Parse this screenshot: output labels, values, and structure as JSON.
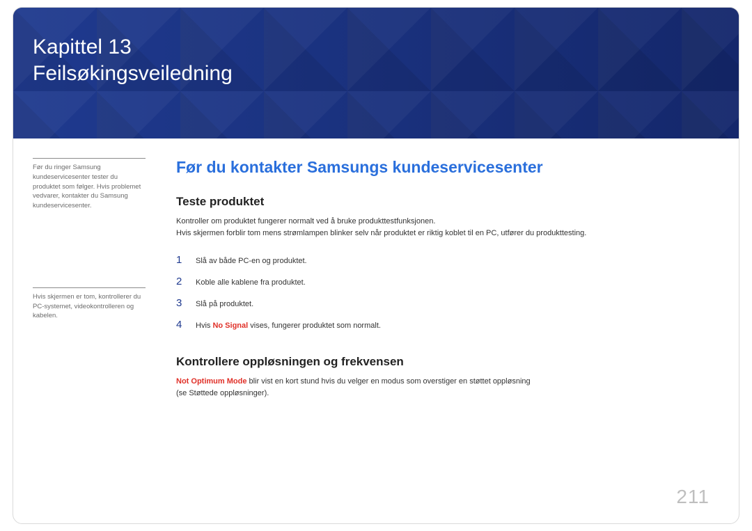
{
  "banner": {
    "line1": "Kapittel 13",
    "line2": "Feilsøkingsveiledning"
  },
  "sidebar": {
    "note1": "Før du ringer Samsung kundeservicesenter tester du produktet som følger. Hvis problemet vedvarer, kontakter du Samsung kundeservicesenter.",
    "note2": "Hvis skjermen er tom, kontrollerer du PC-systemet, videokontrolleren og kabelen."
  },
  "main": {
    "section_title": "Før du kontakter Samsungs kundeservicesenter",
    "sub1_title": "Teste produktet",
    "sub1_para": "Kontroller om produktet fungerer normalt ved å bruke produkttestfunksjonen.\nHvis skjermen forblir tom mens strømlampen blinker selv når produktet er riktig koblet til en PC, utfører du produkttesting.",
    "steps": [
      {
        "n": "1",
        "text": "Slå av både PC-en og produktet."
      },
      {
        "n": "2",
        "text": "Koble alle kablene fra produktet."
      },
      {
        "n": "3",
        "text": "Slå på produktet."
      },
      {
        "n": "4",
        "prefix": "Hvis ",
        "warn": "No Signal",
        "suffix": " vises, fungerer produktet som normalt."
      }
    ],
    "sub2_title": "Kontrollere oppløsningen og frekvensen",
    "sub2_warn": "Not Optimum Mode",
    "sub2_rest": " blir vist en kort stund hvis du velger en modus som overstiger en støttet oppløsning",
    "sub2_line2": "(se Støttede oppløsninger)."
  },
  "page_number": "211"
}
